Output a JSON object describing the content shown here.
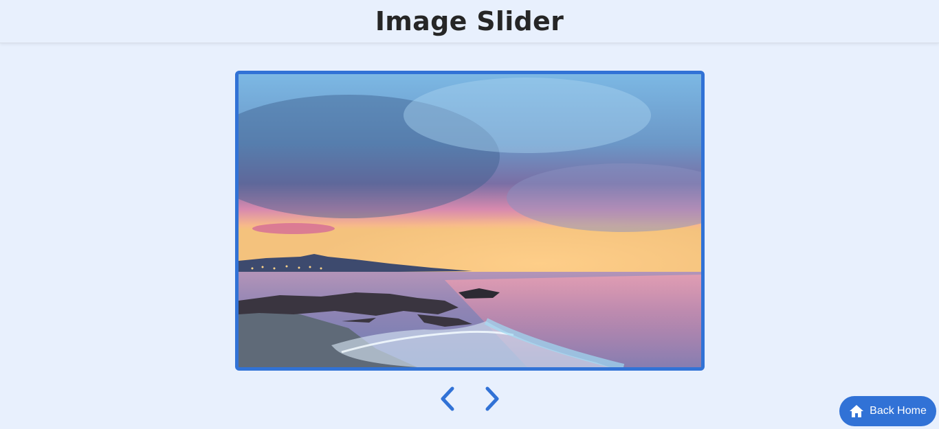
{
  "header": {
    "title": "Image Slider"
  },
  "slider": {
    "frame_color": "#3172d6",
    "current_image": "seaside-sunset",
    "prev_icon": "chevron-left-icon",
    "next_icon": "chevron-right-icon"
  },
  "back_home": {
    "label": "Back Home",
    "icon": "home-icon",
    "color": "#3172d6"
  }
}
